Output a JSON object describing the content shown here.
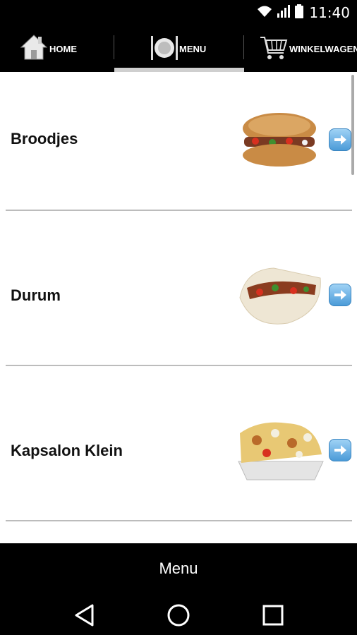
{
  "status_bar": {
    "time": "11:40"
  },
  "tabs": [
    {
      "label": "HOME",
      "icon": "house-icon"
    },
    {
      "label": "MENU",
      "icon": "plate-cutlery-icon",
      "active": true
    },
    {
      "label": "WINKELWAGEN",
      "icon": "shopping-cart-icon"
    }
  ],
  "categories": [
    {
      "title": "Broodjes",
      "image": "doner-sandwich-photo"
    },
    {
      "title": "Durum",
      "image": "durum-wrap-photo"
    },
    {
      "title": "Kapsalon Klein",
      "image": "kapsalon-tray-photo"
    }
  ],
  "bottom_bar": {
    "title": "Menu"
  },
  "nav": {
    "back": "back-icon",
    "home": "home-circle-icon",
    "recents": "recents-square-icon"
  },
  "colors": {
    "bar": "#000000",
    "accent_arrow": "#4b9bd8",
    "separator": "#bcbcbc"
  }
}
